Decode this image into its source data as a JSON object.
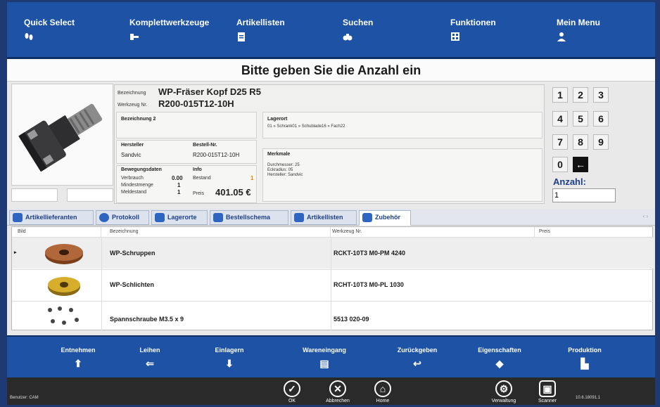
{
  "nav": {
    "items": [
      {
        "label": "Quick Select",
        "icon": "footprints-icon"
      },
      {
        "label": "Komplettwerkzeuge",
        "icon": "tool-assembly-icon"
      },
      {
        "label": "Artikellisten",
        "icon": "clipboard-icon"
      },
      {
        "label": "Suchen",
        "icon": "binoculars-icon"
      },
      {
        "label": "Funktionen",
        "icon": "calculator-icon"
      },
      {
        "label": "Mein Menu",
        "icon": "user-icon"
      }
    ]
  },
  "title": "Bitte geben Sie die Anzahl ein",
  "detail": {
    "bezeichnung_label": "Bezeichnung",
    "bezeichnung": "WP-Fräser Kopf D25 R5",
    "werkzeug_label": "Werkzeug Nr.",
    "werkzeug": "R200-015T12-10H",
    "bez2_label": "Bezeichnung 2",
    "lagerort_label": "Lagerort",
    "lagerort": "01 » Schrank01 » Schublade16 » Fach22",
    "hersteller_label": "Hersteller",
    "hersteller": "Sandvic",
    "bestell_label": "Bestell-Nr.",
    "bestell": "R200-015T12-10H",
    "merkmale_label": "Merkmale",
    "merkmale": [
      "Durchmesser: 25",
      "Eckradius: 05",
      "Hersteller: Sandvic"
    ],
    "bewegung_label": "Bewegungsdaten",
    "info_label": "Info",
    "verbrauch_label": "Verbrauch",
    "verbrauch": "0.00",
    "bestand_label": "Bestand",
    "bestand": "1",
    "mindest_label": "Mindestmenge",
    "mindest": "1",
    "melde_label": "Meldestand",
    "melde": "1",
    "preis_label": "Preis",
    "preis": "401.05 €"
  },
  "keypad": {
    "keys": [
      "1",
      "2",
      "3",
      "4",
      "5",
      "6",
      "7",
      "8",
      "9",
      "0",
      "←"
    ],
    "anzahl_label": "Anzahl:",
    "anzahl_value": "1"
  },
  "tabs": [
    {
      "label": "Artikellieferanten"
    },
    {
      "label": "Protokoll"
    },
    {
      "label": "Lagerorte"
    },
    {
      "label": "Bestellschema"
    },
    {
      "label": "Artikellisten"
    },
    {
      "label": "Zubehör",
      "active": true
    }
  ],
  "grid": {
    "headers": [
      "Bild",
      "Bezeichnung",
      "Werkzeug Nr.",
      "Preis"
    ],
    "rows": [
      {
        "name": "WP-Schruppen",
        "nr": "RCKT-10T3 M0-PM 4240"
      },
      {
        "name": "WP-Schlichten",
        "nr": "RCHT-10T3 M0-PL 1030"
      },
      {
        "name": "Spannschraube M3.5 x 9",
        "nr": "5513 020-09"
      }
    ]
  },
  "actions": [
    {
      "label": "Entnehmen",
      "icon": "upload-tray-icon"
    },
    {
      "label": "Leihen",
      "icon": "lend-icon"
    },
    {
      "label": "Einlagern",
      "icon": "download-tray-icon"
    },
    {
      "label": "Wareneingang",
      "icon": "goods-receipt-icon"
    },
    {
      "label": "Zurückgeben",
      "icon": "return-icon"
    },
    {
      "label": "Eigenschaften",
      "icon": "cube-icon"
    },
    {
      "label": "Produktion",
      "icon": "factory-icon"
    }
  ],
  "footer": {
    "user": "Benutzer: CAM",
    "version": "10.6.18091.1",
    "buttons": [
      {
        "label": "OK",
        "icon": "check-icon"
      },
      {
        "label": "Abbrechen",
        "icon": "cancel-icon"
      },
      {
        "label": "Home",
        "icon": "home-icon"
      },
      {
        "label": "Verwaltung",
        "icon": "admin-icon"
      },
      {
        "label": "Scanner",
        "icon": "scanner-icon"
      }
    ]
  }
}
